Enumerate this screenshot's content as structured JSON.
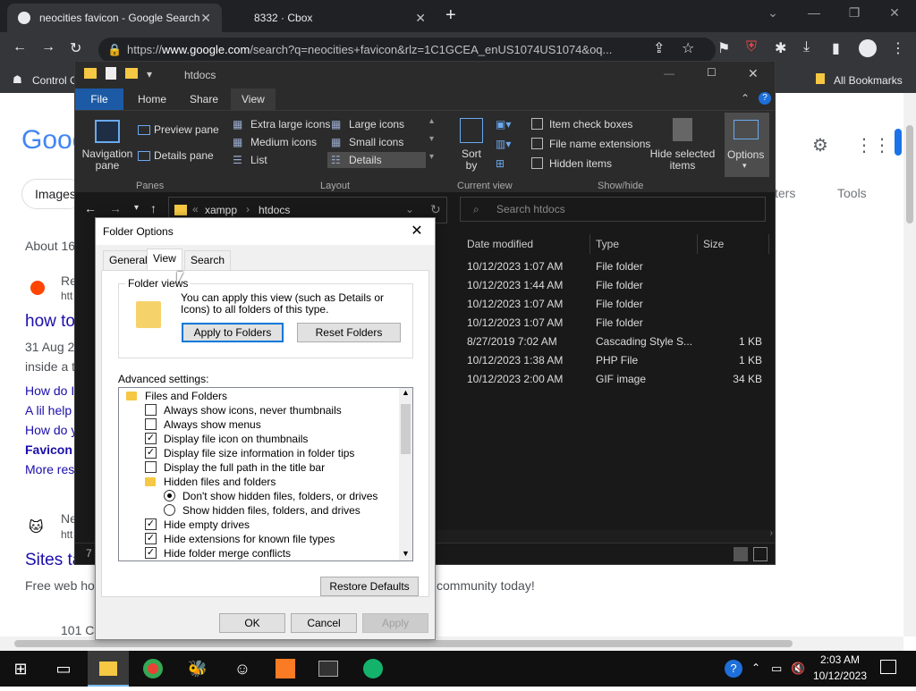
{
  "chrome": {
    "tabs": [
      {
        "title": "neocities favicon - Google Search",
        "active": true
      },
      {
        "title": "8332 · Cbox",
        "active": false
      }
    ],
    "new_tab": "+",
    "url_prefix": "https://",
    "url_host": "www.google.com",
    "url_path": "/search?q=neocities+favicon&rlz=1C1GCEA_enUS1074US1074&oq...",
    "bookmarks": {
      "left": "Control C",
      "right": "All Bookmarks"
    }
  },
  "google": {
    "logo": "Goog",
    "images_chip": "Images",
    "filters": "ters",
    "tools": "Tools",
    "about": "About 16",
    "result1_site": "Re",
    "result1_url": "htt",
    "result1_title": "how to",
    "result1_date": "31 Aug 2",
    "result1_snippet": "inside a t",
    "links": [
      "How do I",
      "A lil help",
      "How do y",
      "Favicon",
      "More res"
    ],
    "result2_site": "Ne",
    "result2_url": "htt",
    "result2_title": "Sites ta",
    "result2_snippet_left": "Free web ho",
    "result2_snippet_right": "community today!",
    "result3": "101 C",
    "status_count": "7"
  },
  "explorer": {
    "title": "htdocs",
    "ribbon_tabs": [
      "File",
      "Home",
      "Share",
      "View"
    ],
    "panes": {
      "navigation": "Navigation pane",
      "preview": "Preview pane",
      "details": "Details pane",
      "group": "Panes"
    },
    "layout": {
      "items": [
        "Extra large icons",
        "Large icons",
        "Medium icons",
        "Small icons",
        "List",
        "Details"
      ],
      "group": "Layout"
    },
    "current_view": {
      "sort": "Sort by",
      "group": "Current view"
    },
    "showhide": {
      "items": [
        "Item check boxes",
        "File name extensions",
        "Hidden items"
      ],
      "hide_selected": "Hide selected items",
      "group": "Show/hide"
    },
    "options": "Options",
    "path": [
      "xampp",
      "htdocs"
    ],
    "search_placeholder": "Search htdocs",
    "columns": [
      "Date modified",
      "Type",
      "Size"
    ],
    "files": [
      {
        "date": "10/12/2023 1:07 AM",
        "type": "File folder",
        "size": ""
      },
      {
        "date": "10/12/2023 1:44 AM",
        "type": "File folder",
        "size": ""
      },
      {
        "date": "10/12/2023 1:07 AM",
        "type": "File folder",
        "size": ""
      },
      {
        "date": "10/12/2023 1:07 AM",
        "type": "File folder",
        "size": ""
      },
      {
        "date": "8/27/2019 7:02 AM",
        "type": "Cascading Style S...",
        "size": "1 KB"
      },
      {
        "date": "10/12/2023 1:38 AM",
        "type": "PHP File",
        "size": "1 KB"
      },
      {
        "date": "10/12/2023 2:00 AM",
        "type": "GIF image",
        "size": "34 KB"
      }
    ]
  },
  "dialog": {
    "title": "Folder Options",
    "tabs": [
      "General",
      "View",
      "Search"
    ],
    "folder_views_label": "Folder views",
    "folder_views_text": "You can apply this view (such as Details or Icons) to all folders of this type.",
    "apply_to_folders": "Apply to Folders",
    "reset_folders": "Reset Folders",
    "advanced_label": "Advanced settings:",
    "advanced": [
      {
        "kind": "folder",
        "label": "Files and Folders",
        "indent": 0
      },
      {
        "kind": "check",
        "label": "Always show icons, never thumbnails",
        "checked": false,
        "indent": 1
      },
      {
        "kind": "check",
        "label": "Always show menus",
        "checked": false,
        "indent": 1
      },
      {
        "kind": "check",
        "label": "Display file icon on thumbnails",
        "checked": true,
        "indent": 1
      },
      {
        "kind": "check",
        "label": "Display file size information in folder tips",
        "checked": true,
        "indent": 1
      },
      {
        "kind": "check",
        "label": "Display the full path in the title bar",
        "checked": false,
        "indent": 1
      },
      {
        "kind": "folder",
        "label": "Hidden files and folders",
        "indent": 1
      },
      {
        "kind": "radio",
        "label": "Don't show hidden files, folders, or drives",
        "checked": true,
        "indent": 2
      },
      {
        "kind": "radio",
        "label": "Show hidden files, folders, and drives",
        "checked": false,
        "indent": 2
      },
      {
        "kind": "check",
        "label": "Hide empty drives",
        "checked": true,
        "indent": 1
      },
      {
        "kind": "check",
        "label": "Hide extensions for known file types",
        "checked": true,
        "indent": 1
      },
      {
        "kind": "check",
        "label": "Hide folder merge conflicts",
        "checked": true,
        "indent": 1
      }
    ],
    "restore_defaults": "Restore Defaults",
    "ok": "OK",
    "cancel": "Cancel",
    "apply": "Apply"
  },
  "taskbar": {
    "time": "2:03 AM",
    "date": "10/12/2023"
  }
}
